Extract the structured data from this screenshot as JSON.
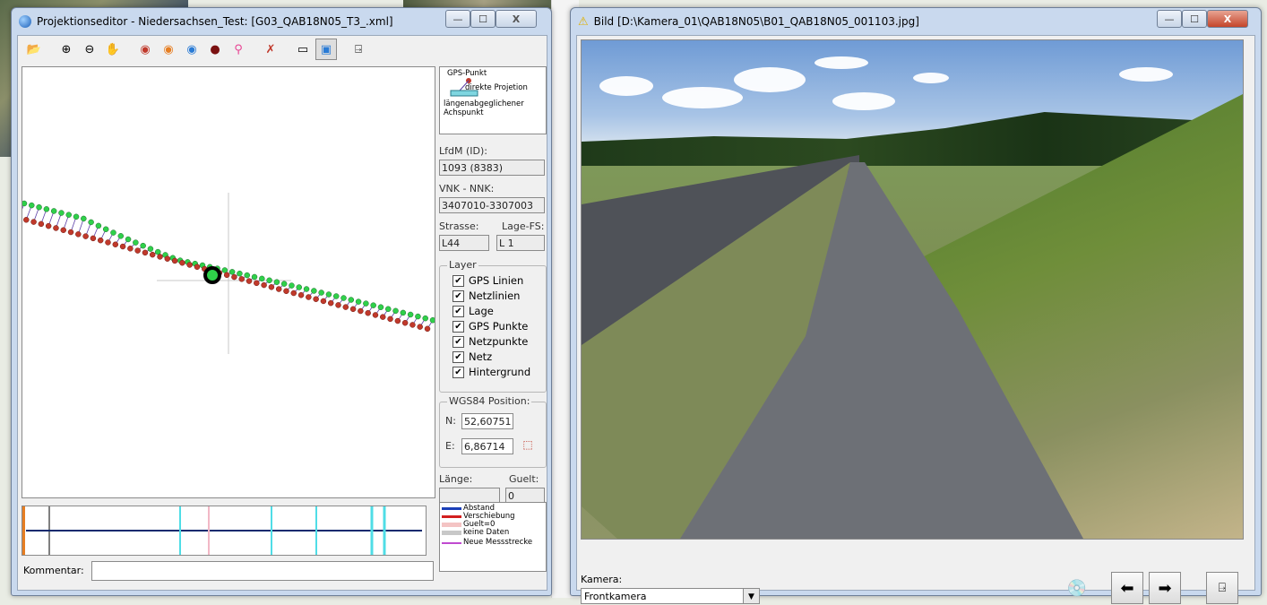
{
  "editor": {
    "title": "Projektionseditor - Niedersachsen_Test: [G03_QAB18N05_T3_.xml]",
    "controls": {
      "minimize": "—",
      "maximize": "☐",
      "close": "X"
    },
    "legend_top": {
      "gps_punkt": "GPS-Punkt",
      "direkte": "direkte Projetion",
      "laengen": "längenabgeglichener Achspunkt"
    },
    "lfdm_label": "LfdM (ID):",
    "lfdm_value": "1093 (8383)",
    "vnk_label": "VNK - NNK:",
    "vnk_value": "3407010-3307003",
    "strasse_label": "Strasse:",
    "strasse_value": "L44",
    "lagefs_label": "Lage-FS:",
    "lagefs_value": "L 1",
    "layer_title": "Layer",
    "layers": [
      "GPS Linien",
      "Netzlinien",
      "Lage",
      "GPS Punkte",
      "Netzpunkte",
      "Netz",
      "Hintergrund"
    ],
    "wgs_title": "WGS84 Position:",
    "n_label": "N:",
    "n_value": "52,60751",
    "e_label": "E:",
    "e_value": "6,86714",
    "laenge_label": "Länge:",
    "guelt_label": "Guelt:",
    "laenge_value": "",
    "guelt_value": "0",
    "legend_bot": [
      "Abstand",
      "Verschiebung",
      "Guelt=0",
      "keine Daten",
      "Neue Messstrecke"
    ],
    "kommentar_label": "Kommentar:"
  },
  "viewer": {
    "title": "Bild [D:\\Kamera_01\\QAB18N05\\B01_QAB18N05_001103.jpg]",
    "camera_label": "Kamera:",
    "camera_value": "Frontkamera"
  },
  "colors": {
    "gps": "#2fd04a",
    "net": "#c0392b",
    "link": "#5b3fa6",
    "accent": "#1b5fb8"
  }
}
